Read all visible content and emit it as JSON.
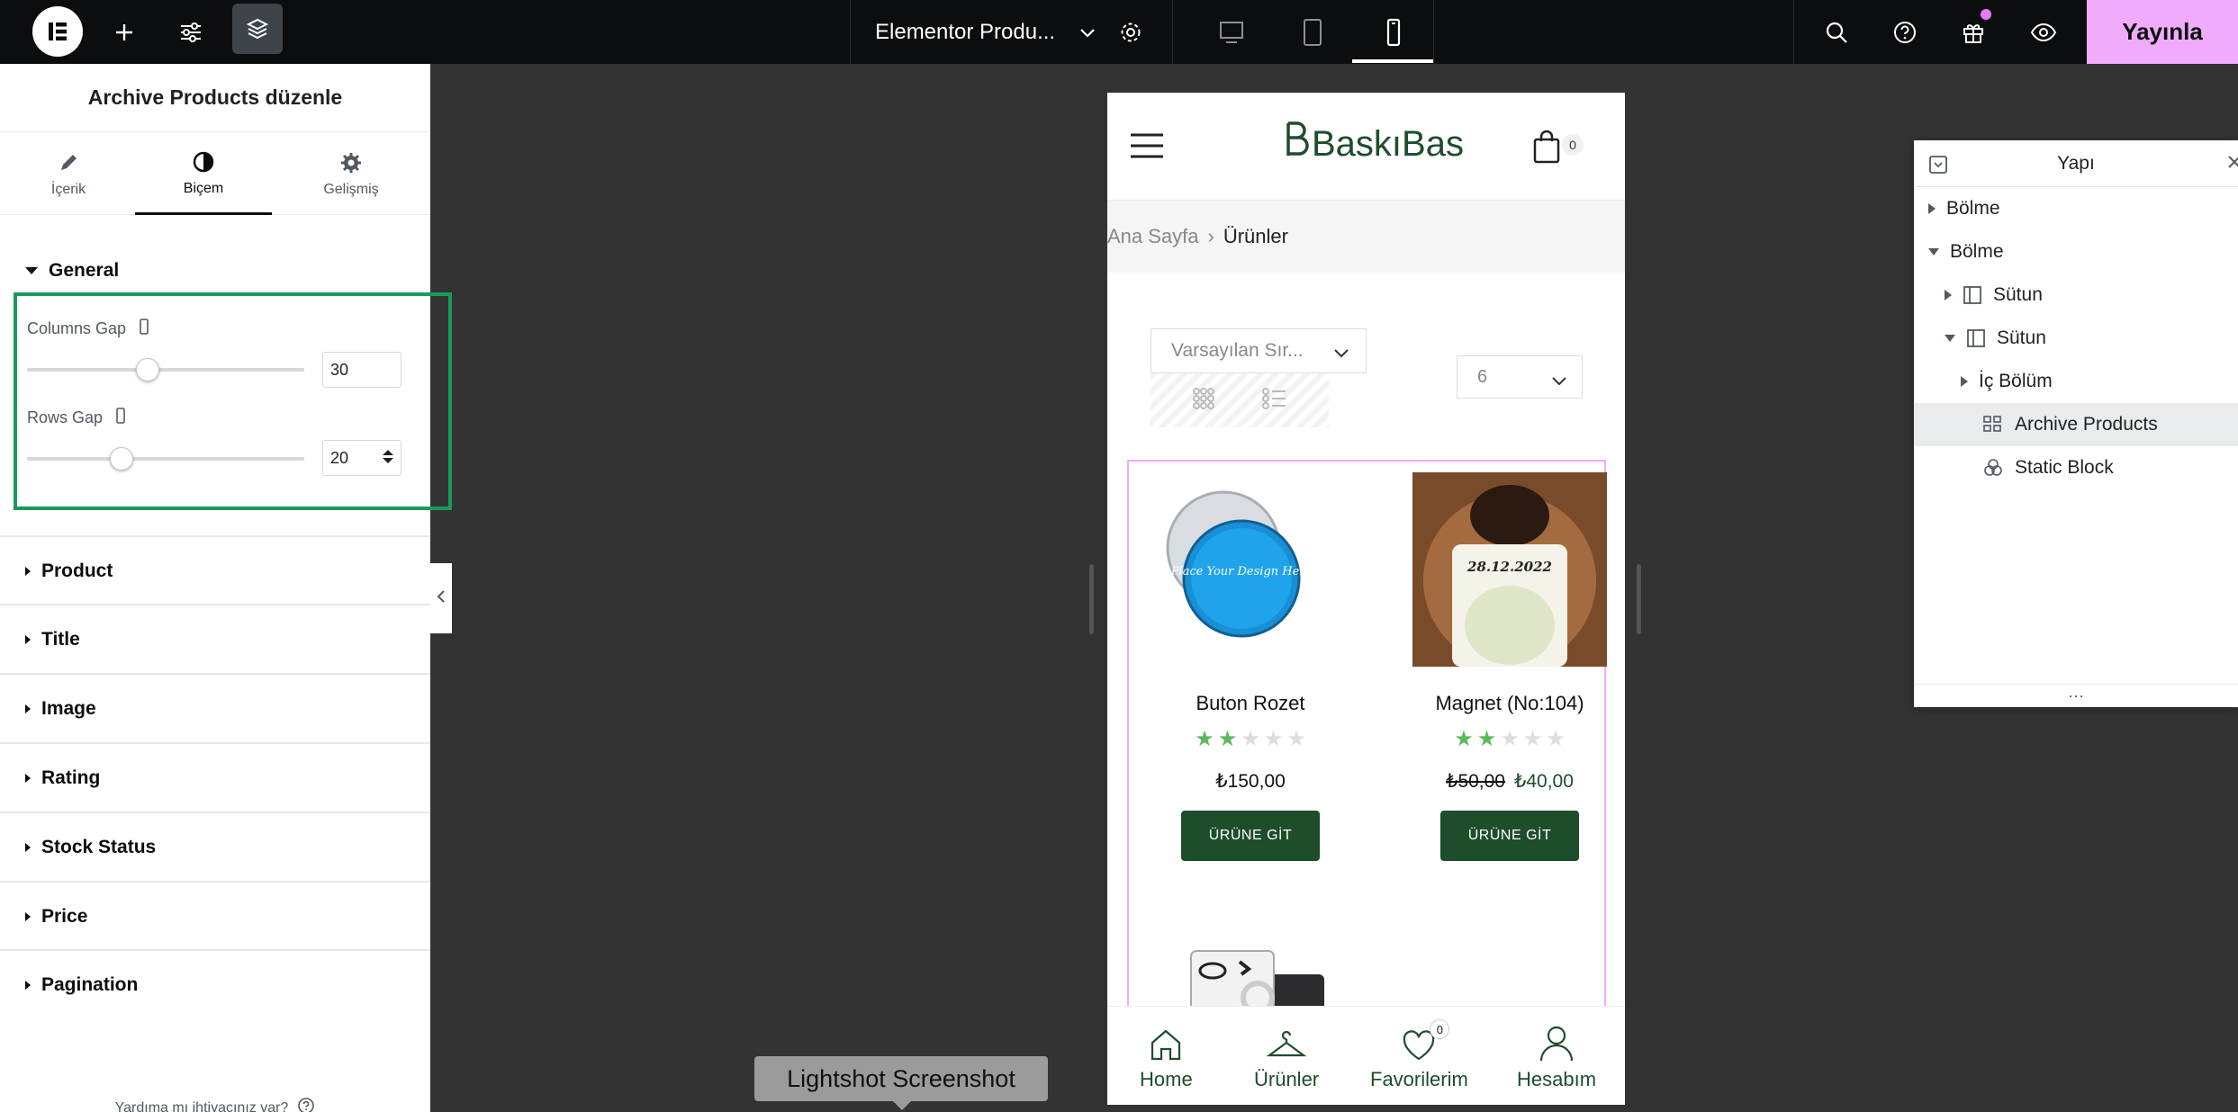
{
  "topbar": {
    "document_title": "Elementor Produ...",
    "publish_label": "Yayınla",
    "accent_color": "#f0abfc"
  },
  "panel": {
    "title": "Archive Products düzenle",
    "tabs": [
      {
        "label": "İçerik",
        "icon": "pencil-icon"
      },
      {
        "label": "Biçem",
        "icon": "half-circle-icon"
      },
      {
        "label": "Gelişmiş",
        "icon": "gear-icon"
      }
    ],
    "active_tab": "Biçem",
    "general": {
      "title": "General",
      "columns_gap": {
        "label": "Columns Gap",
        "value": "30",
        "fraction": 0.3
      },
      "rows_gap": {
        "label": "Rows Gap",
        "value": "20",
        "fraction": 0.2
      }
    },
    "sections": [
      "Product",
      "Title",
      "Image",
      "Rating",
      "Stock Status",
      "Price",
      "Pagination"
    ],
    "help_text": "Yardıma mı ihtiyacınız var?"
  },
  "preview": {
    "brand": "BaskıBas",
    "cart_count": "0",
    "breadcrumb": {
      "home": "Ana Sayfa",
      "current": "Ürünler"
    },
    "sort_value": "Varsayılan Sır...",
    "per_page_value": "6",
    "products": [
      {
        "name": "Buton Rozet",
        "rating": 2,
        "price": "₺150,00",
        "old_price": "",
        "button": "ÜRÜNE GİT",
        "image_text": "Place Your Design Here"
      },
      {
        "name": "Magnet (No:104)",
        "rating": 2,
        "price": "₺40,00",
        "old_price": "₺50,00",
        "button": "ÜRÜNE GİT",
        "image_text": "28.12.2022"
      }
    ],
    "bottom_nav": [
      {
        "label": "Home",
        "icon": "home-icon"
      },
      {
        "label": "Ürünler",
        "icon": "hanger-icon"
      },
      {
        "label": "Favorilerim",
        "icon": "heart-icon",
        "badge": "0"
      },
      {
        "label": "Hesabım",
        "icon": "user-icon"
      }
    ],
    "brand_color": "#1e4d2b"
  },
  "lightshot_label": "Lightshot Screenshot",
  "navigator": {
    "title": "Yapı",
    "items": [
      {
        "label": "Bölme",
        "expand": "collapsed",
        "icon": ""
      },
      {
        "label": "Bölme",
        "expand": "expanded",
        "icon": ""
      },
      {
        "label": "Sütun",
        "expand": "collapsed",
        "icon": "column-icon"
      },
      {
        "label": "Sütun",
        "expand": "expanded",
        "icon": "column-icon"
      },
      {
        "label": "İç Bölüm",
        "expand": "collapsed",
        "icon": ""
      },
      {
        "label": "Archive Products",
        "expand": "none",
        "icon": "products-grid-icon",
        "selected": true
      },
      {
        "label": "Static Block",
        "expand": "none",
        "icon": "blocks-icon"
      }
    ]
  }
}
